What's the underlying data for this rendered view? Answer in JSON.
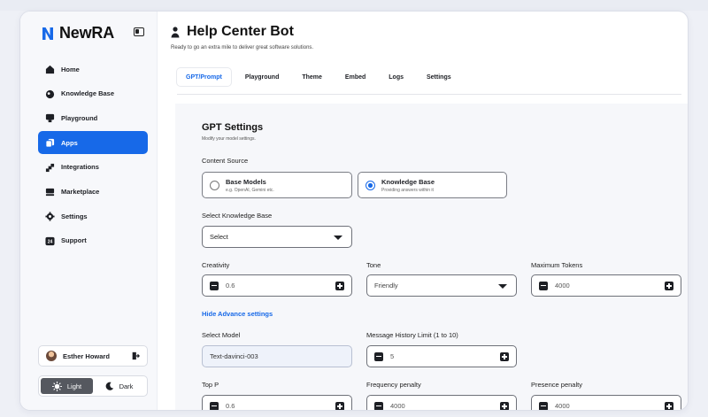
{
  "brand": {
    "name": "NewRA"
  },
  "sidebar": {
    "items": [
      {
        "label": "Home",
        "icon": "home-icon"
      },
      {
        "label": "Knowledge Base",
        "icon": "knowledge-icon"
      },
      {
        "label": "Playground",
        "icon": "playground-icon"
      },
      {
        "label": "Apps",
        "icon": "apps-icon",
        "active": true
      },
      {
        "label": "Integrations",
        "icon": "integrations-icon"
      },
      {
        "label": "Marketplace",
        "icon": "marketplace-icon"
      },
      {
        "label": "Settings",
        "icon": "gear-icon"
      },
      {
        "label": "Support",
        "icon": "support-icon"
      }
    ],
    "support_badge": "24",
    "user_name": "Esther Howard",
    "theme": {
      "light": "Light",
      "dark": "Dark",
      "selected": "Light"
    }
  },
  "header": {
    "title": "Help Center Bot",
    "subtitle": "Ready to go an extra mile to deliver great software solutions."
  },
  "tabs": [
    {
      "label": "GPT/Prompt",
      "active": true
    },
    {
      "label": "Playground"
    },
    {
      "label": "Theme"
    },
    {
      "label": "Embed"
    },
    {
      "label": "Logs"
    },
    {
      "label": "Settings"
    }
  ],
  "gpt": {
    "heading": "GPT Settings",
    "subheading": "Modify your model settings.",
    "content_source_label": "Content Source",
    "base_models": {
      "title": "Base Models",
      "sub": "e.g. OpenAI, Gemini etc."
    },
    "knowledge_base": {
      "title": "Knowledge Base",
      "sub": "Providing answers within it"
    },
    "select_kb_label": "Select Knowledge Base",
    "select_kb_value": "Select",
    "creativity_label": "Creativity",
    "creativity_value": "0.6",
    "tone_label": "Tone",
    "tone_value": "Friendly",
    "max_tokens_label": "Maximum Tokens",
    "max_tokens_value": "4000",
    "advanced_link": "Hide Advance settings",
    "model_label": "Select Model",
    "model_value": "Text-davinci-003",
    "history_label": "Message History Limit (1 to 10)",
    "history_value": "5",
    "top_p_label": "Top P",
    "top_p_value": "0.6",
    "freq_label": "Frequency penalty",
    "freq_value": "4000",
    "presence_label": "Presence penalty",
    "presence_value": "4000"
  },
  "colors": {
    "accent": "#1769e8",
    "dark": "#1d1f24"
  }
}
